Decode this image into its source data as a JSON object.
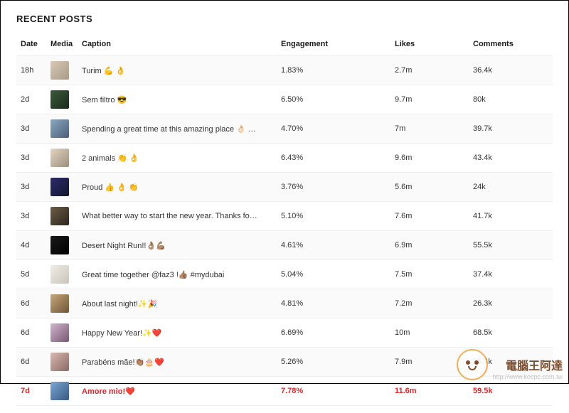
{
  "title": "RECENT POSTS",
  "columns": {
    "date": "Date",
    "media": "Media",
    "caption": "Caption",
    "engagement": "Engagement",
    "likes": "Likes",
    "comments": "Comments"
  },
  "rows": [
    {
      "date": "18h",
      "caption": "Turim 💪 👌",
      "engagement": "1.83%",
      "likes": "2.7m",
      "comments": "36.4k",
      "thumb_bg": "linear-gradient(135deg,#d9c8b6,#a89b88)",
      "highlight": false
    },
    {
      "date": "2d",
      "caption": "Sem filtro 😎",
      "engagement": "6.50%",
      "likes": "9.7m",
      "comments": "80k",
      "thumb_bg": "linear-gradient(135deg,#3a5a3d,#1b2a1b)",
      "highlight": false
    },
    {
      "date": "3d",
      "caption": "Spending a great time at this amazing place 👌🏻 …",
      "engagement": "4.70%",
      "likes": "7m",
      "comments": "39.7k",
      "thumb_bg": "linear-gradient(135deg,#8aa6c2,#4c6077)",
      "highlight": false
    },
    {
      "date": "3d",
      "caption": "2 animals 👏 👌",
      "engagement": "6.43%",
      "likes": "9.6m",
      "comments": "43.4k",
      "thumb_bg": "linear-gradient(135deg,#e3d5c3,#9b8e7a)",
      "highlight": false
    },
    {
      "date": "3d",
      "caption": "Proud 👍 👌 👏",
      "engagement": "3.76%",
      "likes": "5.6m",
      "comments": "24k",
      "thumb_bg": "linear-gradient(135deg,#2c2c6b,#14142f)",
      "highlight": false
    },
    {
      "date": "3d",
      "caption": "What better way to start the new year. Thanks fo…",
      "engagement": "5.10%",
      "likes": "7.6m",
      "comments": "41.7k",
      "thumb_bg": "linear-gradient(135deg,#6b5d47,#2d261b)",
      "highlight": false
    },
    {
      "date": "4d",
      "caption": "Desert Night Run!!👌🏽💪🏽",
      "engagement": "4.61%",
      "likes": "6.9m",
      "comments": "55.5k",
      "thumb_bg": "linear-gradient(135deg,#1a1a1a,#000000)",
      "highlight": false
    },
    {
      "date": "5d",
      "caption": "Great time together @faz3 !👍🏽 #mydubai",
      "engagement": "5.04%",
      "likes": "7.5m",
      "comments": "37.4k",
      "thumb_bg": "linear-gradient(135deg,#f0ede7,#c9c4ba)",
      "highlight": false
    },
    {
      "date": "6d",
      "caption": "About last night!✨🎉",
      "engagement": "4.81%",
      "likes": "7.2m",
      "comments": "26.3k",
      "thumb_bg": "linear-gradient(135deg,#c7a77c,#6e5637)",
      "highlight": false
    },
    {
      "date": "6d",
      "caption": "Happy New Year!✨❤️",
      "engagement": "6.69%",
      "likes": "10m",
      "comments": "68.5k",
      "thumb_bg": "linear-gradient(135deg,#cfb7cc,#7a5773)",
      "highlight": false
    },
    {
      "date": "6d",
      "caption": "Parabéns mãe!👏🏽🎂❤️",
      "engagement": "5.26%",
      "likes": "7.9m",
      "comments": "55.4k",
      "thumb_bg": "linear-gradient(135deg,#d9b8b1,#8a6a63)",
      "highlight": false
    },
    {
      "date": "7d",
      "caption": "Amore mio!❤️",
      "engagement": "7.78%",
      "likes": "11.6m",
      "comments": "59.5k",
      "thumb_bg": "linear-gradient(135deg,#7aa6d6,#3a5a80)",
      "highlight": true
    }
  ],
  "watermark": {
    "text_zh": "電腦王阿達",
    "url": "http://www.kocpc.com.tw"
  }
}
